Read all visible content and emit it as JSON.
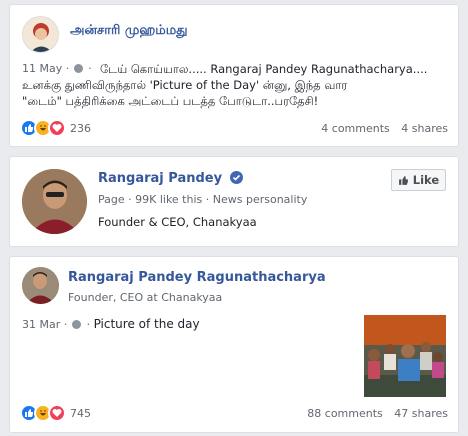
{
  "post1": {
    "author": "அன்சாரி முஹம்மது",
    "date": "11 May",
    "text_line1": "டேய் கொய்யால..... Rangaraj Pandey Ragunathacharya....",
    "text_line2": "உனக்கு துணிவிருந்தால் 'Picture of the Day' ன்னு, இந்த வார",
    "text_line3": "\"டைம்\" பத்திரிக்கை அட்டைப் படத்த போடுடா..பரதேசி!",
    "reactions_count": "236",
    "comments": "4 comments",
    "shares": "4 shares"
  },
  "page_card": {
    "name": "Rangaraj Pandey",
    "meta": "Page · 99K like this · News personality",
    "description": "Founder & CEO, Chanakyaa",
    "like_button": "Like"
  },
  "post2": {
    "author": "Rangaraj Pandey Ragunathacharya",
    "subtitle": "Founder, CEO at Chanakyaa",
    "date": "31 Mar",
    "text": "Picture of the day",
    "reactions_count": "745",
    "comments": "88 comments",
    "shares": "47 shares"
  },
  "icons": {
    "verified": "verified-badge-icon",
    "globe": "globe-icon",
    "like": "like-reaction-icon",
    "haha": "haha-reaction-icon",
    "love": "love-reaction-icon"
  }
}
